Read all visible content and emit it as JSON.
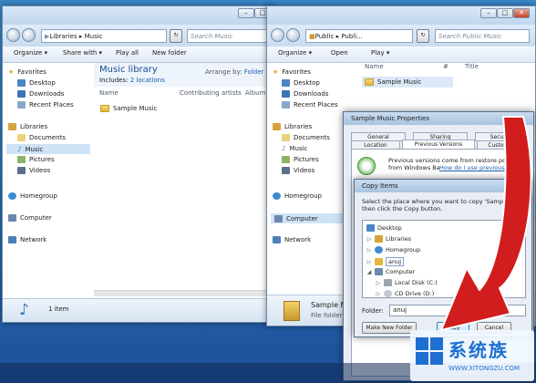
{
  "colors": {
    "accent": "#1c4f9a",
    "arrow": "#d11d1d",
    "link": "#1a5fb4"
  },
  "left_window": {
    "nav": {
      "address": [
        "Libraries",
        "Music"
      ],
      "search_placeholder": "Search Music"
    },
    "commands": [
      "Organize ▾",
      "Share with ▾",
      "Play all",
      "New folder"
    ],
    "sidebar": {
      "favorites": "Favorites",
      "favorite_items": [
        "Desktop",
        "Downloads",
        "Recent Places"
      ],
      "libraries": "Libraries",
      "library_items": [
        "Documents",
        "Music",
        "Pictures",
        "Videos"
      ],
      "homegroup": "Homegroup",
      "computer": "Computer",
      "network": "Network"
    },
    "library_title": "Music library",
    "includes_label": "Includes:",
    "includes_link": "2 locations",
    "arrange_by": "Arrange by:",
    "arrange_value": "Folder",
    "columns": [
      "Name",
      "Contributing artists",
      "Album"
    ],
    "item": "Sample Music",
    "status": "1 item"
  },
  "right_window": {
    "nav": {
      "address": [
        "Public",
        "Publi..."
      ],
      "search_placeholder": "Search Public Music"
    },
    "commands": [
      "Organize ▾",
      "Open",
      "Play ▾"
    ],
    "sidebar": {
      "favorites": "Favorites",
      "favorite_items": [
        "Desktop",
        "Downloads",
        "Recent Places"
      ],
      "libraries": "Libraries",
      "library_items": [
        "Documents",
        "Music",
        "Pictures",
        "Videos"
      ],
      "homegroup": "Homegroup",
      "computer": "Computer",
      "network": "Network"
    },
    "columns": [
      "Name",
      "#",
      "Title"
    ],
    "item": "Sample Music",
    "status_name": "Sample M",
    "status_type": "File folder"
  },
  "properties_dialog": {
    "title": "Sample Music Properties",
    "tabs_row1": [
      "General",
      "Sharing",
      "Security"
    ],
    "tabs_row2": [
      "Location",
      "Previous Versions",
      "Customize"
    ],
    "description": "Previous versions come from restore points or from Windows Backup.",
    "link": "How do I use previous versions?"
  },
  "copy_dialog": {
    "title": "Copy Items",
    "instruction": "Select the place where you want to copy 'Sample M', then click the Copy button.",
    "tree": [
      "Desktop",
      "Libraries",
      "Homegroup",
      "anuj",
      "Computer",
      "Local Disk (C:)",
      "CD Drive (D:)"
    ],
    "folder_label": "Folder:",
    "folder_value": "anuj",
    "new_folder_button": "Make New Folder",
    "copy_button": "Copy",
    "cancel_button": "Cancel"
  },
  "watermark": {
    "brand": "系统族",
    "url": "WWW.XITONGZU.COM"
  }
}
